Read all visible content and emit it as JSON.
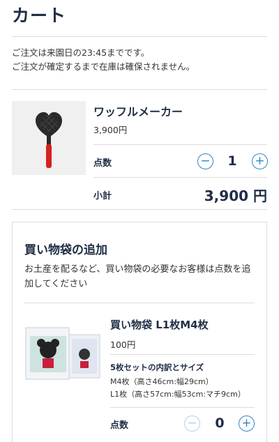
{
  "header": {
    "title": "カート"
  },
  "notice": {
    "line1": "ご注文は来園日の23:45までです。",
    "line2": "ご注文が確定するまで在庫は確保されません。"
  },
  "cart_item": {
    "name": "ワッフルメーカー",
    "price": "3,900円",
    "quantity_label": "点数",
    "quantity": "1",
    "subtotal_label": "小計",
    "subtotal": "3,900 円",
    "image_icon": "waffle-maker-icon"
  },
  "bag_section": {
    "title": "買い物袋の追加",
    "description": "お土産を配るなど、買い物袋の必要なお客様は点数を追加してください",
    "product": {
      "name": "買い物袋 L1枚M4枚",
      "price": "100円",
      "detail_title": "5枚セットの内訳とサイズ",
      "detail_line1": "M4枚（高さ46cm:幅29cm）",
      "detail_line2": "L1枚（高さ57cm:幅53cm:マチ9cm）",
      "quantity_label": "点数",
      "quantity": "0"
    }
  },
  "colors": {
    "accent": "#2e86c8",
    "text": "#1f2d45",
    "disabled": "#b9cfe0"
  }
}
